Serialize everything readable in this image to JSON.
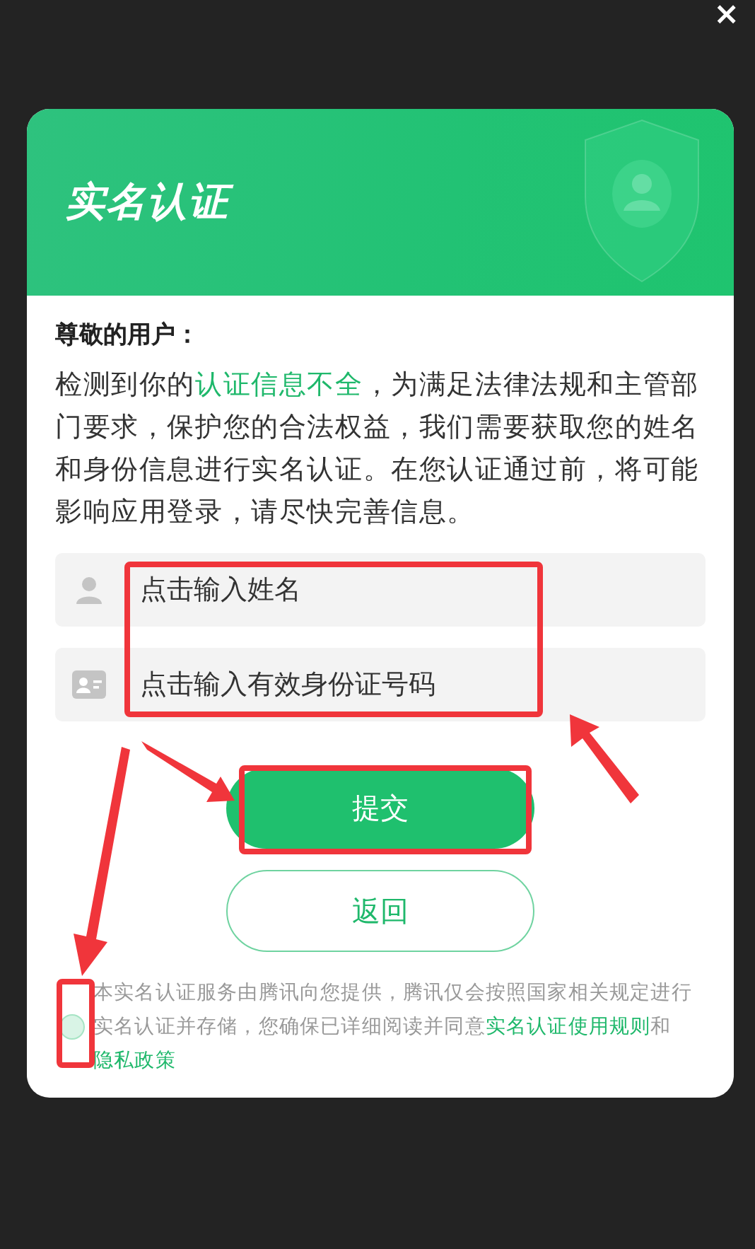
{
  "close_button": {
    "label": "×"
  },
  "dialog": {
    "title": "实名认证",
    "greeting": "尊敬的用户：",
    "notice": [
      {
        "text": "检测到你的",
        "highlight": false
      },
      {
        "text": "认证信息不全",
        "highlight": true
      },
      {
        "text": "，为满足法律法规和主管部门要求，保护您的合法权益，我们需要获取您的姓名和身份信息进行实名认证。在您认证通过前，将可能影响应用登录，请尽快完善信息。",
        "highlight": false
      }
    ],
    "fields": [
      {
        "kind": "name",
        "placeholder": "点击输入姓名"
      },
      {
        "kind": "id",
        "placeholder": "点击输入有效身份证号码"
      }
    ],
    "submit_button": "提交",
    "back_button": "返回",
    "agreement": {
      "checked": false,
      "parts": [
        {
          "kind": "text",
          "text": "本实名认证服务由腾讯向您提供，腾讯仅会按照国家相关规定进行实名认证并存储，您确保已详细阅读并同意"
        },
        {
          "kind": "link",
          "text": "实名认证使用规则"
        },
        {
          "kind": "text",
          "text": "和"
        },
        {
          "kind": "link",
          "text": "隐私政策"
        }
      ]
    }
  }
}
